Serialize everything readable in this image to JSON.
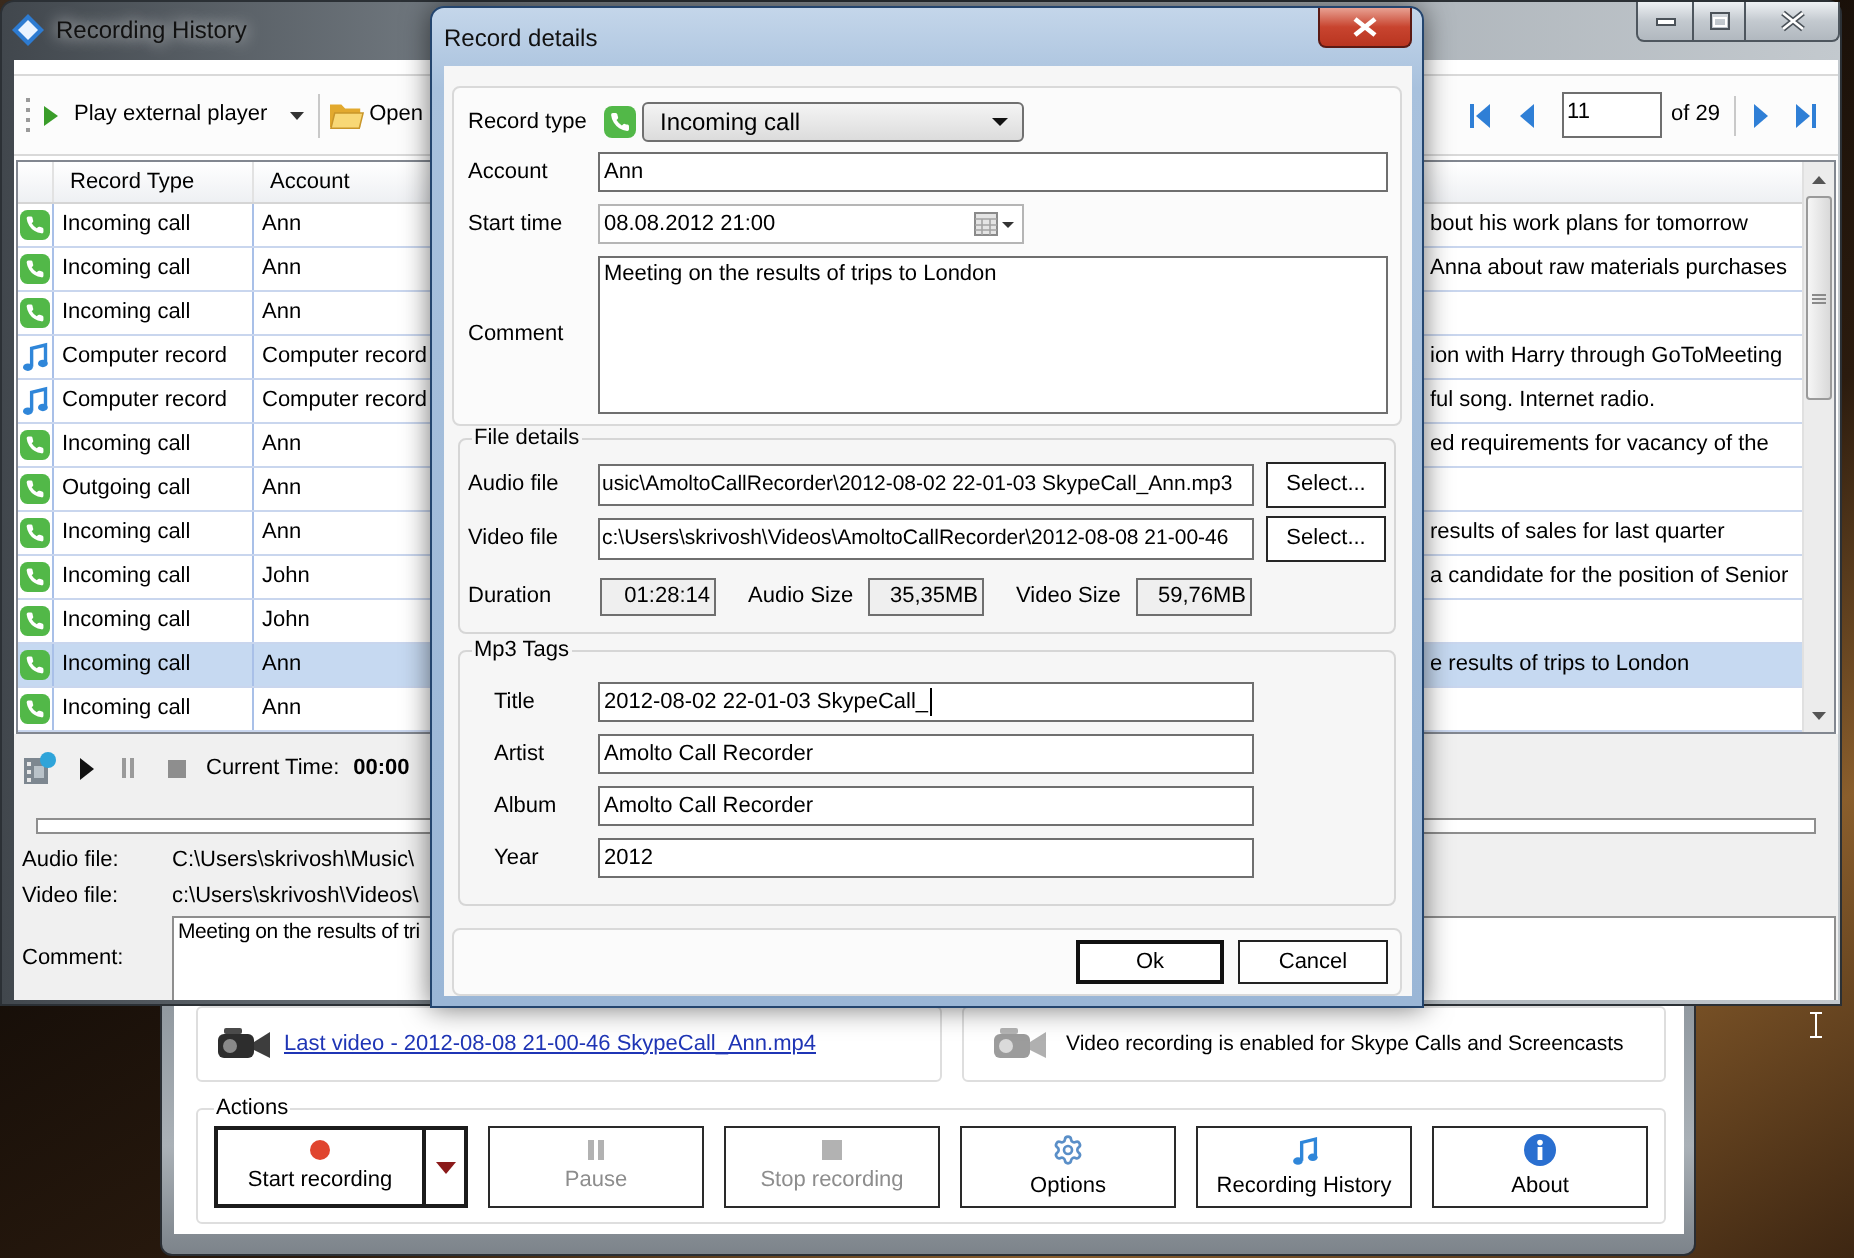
{
  "history_window": {
    "title": "Recording History",
    "toolbar": {
      "play_button": "Play external player",
      "open_button": "Open",
      "page_field": "11",
      "page_total": "of 29"
    },
    "table": {
      "columns": [
        "Record Type",
        "Account"
      ],
      "rows": [
        {
          "kind": "call",
          "record_type": "Incoming call",
          "account": "Ann",
          "comment": "bout his work plans for tomorrow",
          "selected": false
        },
        {
          "kind": "call",
          "record_type": "Incoming call",
          "account": "Ann",
          "comment": "Anna about raw materials purchases",
          "selected": false
        },
        {
          "kind": "call",
          "record_type": "Incoming call",
          "account": "Ann",
          "selected": false
        },
        {
          "kind": "computer",
          "record_type": "Computer record",
          "account": "Computer record",
          "comment": "ion with Harry through GoToMeeting",
          "selected": false
        },
        {
          "kind": "computer",
          "record_type": "Computer record",
          "account": "Computer record",
          "comment": "ful song. Internet radio.",
          "selected": false
        },
        {
          "kind": "call",
          "record_type": "Incoming call",
          "account": "Ann",
          "comment": "ed requirements for vacancy of the",
          "selected": false
        },
        {
          "kind": "call",
          "record_type": "Outgoing call",
          "account": "Ann",
          "selected": false
        },
        {
          "kind": "call",
          "record_type": "Incoming call",
          "account": "Ann",
          "comment": "results of sales for last quarter",
          "selected": false
        },
        {
          "kind": "call",
          "record_type": "Incoming call",
          "account": "John",
          "comment": "a candidate for the position of Senior",
          "selected": false
        },
        {
          "kind": "call",
          "record_type": "Incoming call",
          "account": "John",
          "selected": false
        },
        {
          "kind": "call",
          "record_type": "Incoming call",
          "account": "Ann",
          "comment": "e results of trips to London",
          "selected": true
        },
        {
          "kind": "call",
          "record_type": "Incoming call",
          "account": "Ann",
          "selected": false
        }
      ]
    },
    "player": {
      "time_label": "Current Time:",
      "time_value": "00:00"
    },
    "audio_file": {
      "label": "Audio file:",
      "value": "C:\\Users\\skrivosh\\Music\\"
    },
    "video_file": {
      "label": "Video file:",
      "value": "c:\\Users\\skrivosh\\Videos\\"
    },
    "comment": {
      "label": "Comment:",
      "value": "Meeting on the results of tri"
    }
  },
  "main_window": {
    "last_video_link": "Last video - 2012-08-08 21-00-46 SkypeCall_Ann.mp4",
    "video_notice": "Video recording is enabled for Skype Calls and Screencasts",
    "actions": {
      "legend": "Actions",
      "buttons": [
        {
          "kind": "record",
          "label": "Start recording",
          "disabled": false,
          "default": true,
          "split": true
        },
        {
          "kind": "pause",
          "label": "Pause",
          "disabled": true,
          "default": false,
          "split": false
        },
        {
          "kind": "stop",
          "label": "Stop recording",
          "disabled": true,
          "default": false,
          "split": false
        },
        {
          "kind": "options",
          "label": "Options",
          "disabled": false,
          "default": false,
          "split": false
        },
        {
          "kind": "history",
          "label": "Recording History",
          "disabled": false,
          "default": false,
          "split": false
        },
        {
          "kind": "about",
          "label": "About",
          "disabled": false,
          "default": false,
          "split": false
        }
      ]
    }
  },
  "dialog": {
    "title": "Record details",
    "record_type": {
      "label": "Record type",
      "kind": "call",
      "value": "Incoming call"
    },
    "account": {
      "label": "Account",
      "value": "Ann"
    },
    "start_time": {
      "label": "Start time",
      "value": "08.08.2012 21:00"
    },
    "comment": {
      "label": "Comment",
      "value": "Meeting on the results of trips to London"
    },
    "file_details": {
      "legend": "File details",
      "audio_file": {
        "label": "Audio file",
        "value": "usic\\AmoltoCallRecorder\\2012-08-02 22-01-03 SkypeCall_Ann.mp3",
        "button": "Select..."
      },
      "video_file": {
        "label": "Video file",
        "value": "c:\\Users\\skrivosh\\Videos\\AmoltoCallRecorder\\2012-08-08 21-00-46",
        "button": "Select..."
      },
      "sizes": [
        {
          "label": "Duration",
          "value": "01:28:14"
        },
        {
          "label": "Audio Size",
          "value": "35,35MB"
        },
        {
          "label": "Video Size",
          "value": "59,76MB"
        }
      ]
    },
    "mp3_tags": {
      "legend": "Mp3 Tags",
      "fields": [
        {
          "label": "Title",
          "value": "2012-08-02 22-01-03 SkypeCall_",
          "focused": true
        },
        {
          "label": "Artist",
          "value": "Amolto Call Recorder",
          "focused": false
        },
        {
          "label": "Album",
          "value": "Amolto Call Recorder",
          "focused": false
        },
        {
          "label": "Year",
          "value": "2012",
          "focused": false
        }
      ]
    },
    "buttons": [
      {
        "label": "Ok",
        "default": true
      },
      {
        "label": "Cancel",
        "default": false
      }
    ]
  }
}
